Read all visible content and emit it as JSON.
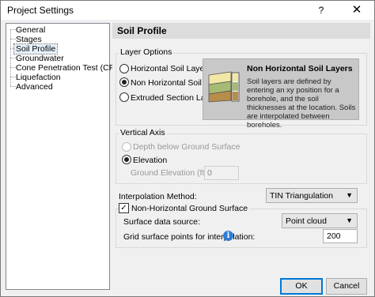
{
  "window": {
    "title": "Project Settings",
    "help_label": "?",
    "close_label": "✕"
  },
  "sidebar": {
    "items": [
      {
        "label": "General"
      },
      {
        "label": "Stages"
      },
      {
        "label": "Soil Profile",
        "selected": true
      },
      {
        "label": "Groundwater"
      },
      {
        "label": "Cone Penetration Test (CPT)"
      },
      {
        "label": "Liquefaction"
      },
      {
        "label": "Advanced"
      }
    ]
  },
  "panel": {
    "title": "Soil Profile",
    "layer_options": {
      "label": "Layer Options",
      "options": [
        {
          "label": "Horizontal Soil Layers",
          "selected": false
        },
        {
          "label": "Non Horizontal Soil Layers",
          "selected": true
        },
        {
          "label": "Extruded Section Layers",
          "selected": false
        }
      ],
      "info_title": "Non Horizontal Soil Layers",
      "info_text": "Soil layers are defined by entering an xy position for a borehole, and the soil thicknesses at the location. Soils are interpolated between boreholes."
    },
    "vertical_axis": {
      "label": "Vertical Axis",
      "options": [
        {
          "label": "Depth below Ground Surface",
          "selected": false,
          "disabled": true
        },
        {
          "label": "Elevation",
          "selected": true,
          "disabled": false
        }
      ],
      "ground_elevation_label": "Ground Elevation (ft):",
      "ground_elevation_value": "0"
    },
    "interpolation": {
      "label": "Interpolation Method:",
      "value": "TIN Triangulation"
    },
    "non_horizontal_ground": {
      "label": "Non-Horizontal Ground Surface",
      "checked": true,
      "surface_source_label": "Surface data source:",
      "surface_source_value": "Point cloud",
      "grid_points_label": "Grid surface points for interpolation:",
      "grid_points_value": "200",
      "info_icon": "info-icon"
    }
  },
  "buttons": {
    "ok": "OK",
    "cancel": "Cancel"
  },
  "colors": {
    "accent": "#0078d7",
    "info_icon": "#2d7fd3",
    "panel_header": "#dcdcdc",
    "info_box": "#c8c8c8"
  }
}
